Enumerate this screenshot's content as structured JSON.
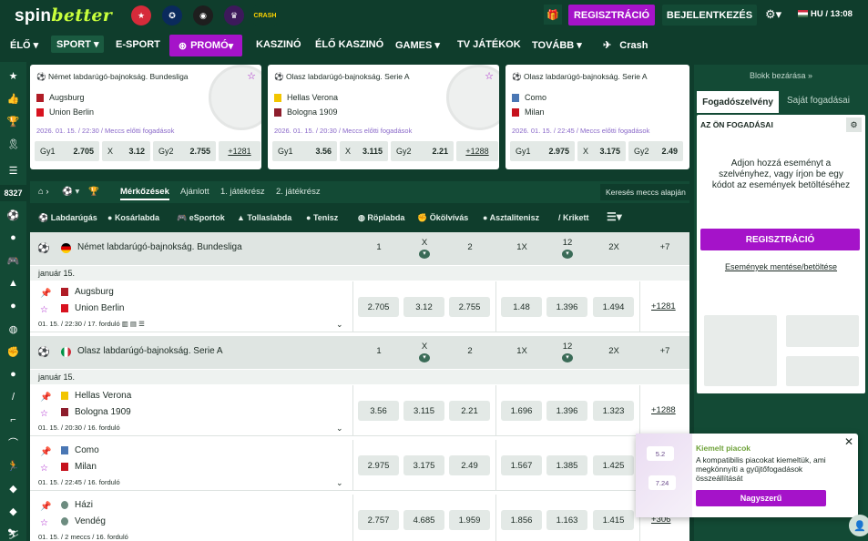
{
  "header": {
    "logo_a": "spin",
    "logo_b": "better",
    "register": "REGISZTRÁCIÓ",
    "login": "BEJELENTKEZÉS",
    "lang_time": "HU / 13:08",
    "crash_badge": "CRASH"
  },
  "nav": {
    "items": [
      "ÉLŐ",
      "SPORT",
      "E-SPORT",
      "PROMÓ",
      "KASZINÓ",
      "ÉLŐ KASZINÓ",
      "GAMES",
      "TV JÁTÉKOK",
      "TOVÁBB",
      "Crash"
    ]
  },
  "sidebar": {
    "count": "8327"
  },
  "cards": [
    {
      "league": "Német labdarúgó-bajnokság. Bundesliga",
      "home": "Augsburg",
      "away": "Union Berlin",
      "when": "2026. 01. 15. / 22:30 / Meccs előtti fogadások",
      "odds": [
        {
          "l": "Gy1",
          "v": "2.705"
        },
        {
          "l": "X",
          "v": "3.12"
        },
        {
          "l": "Gy2",
          "v": "2.755"
        }
      ],
      "more": "+1281"
    },
    {
      "league": "Olasz labdarúgó-bajnokság. Serie A",
      "home": "Hellas Verona",
      "away": "Bologna 1909",
      "when": "2026. 01. 15. / 20:30 / Meccs előtti fogadások",
      "odds": [
        {
          "l": "Gy1",
          "v": "3.56"
        },
        {
          "l": "X",
          "v": "3.115"
        },
        {
          "l": "Gy2",
          "v": "2.21"
        }
      ],
      "more": "+1288"
    },
    {
      "league": "Olasz labdarúgó-bajnokság. Serie A",
      "home": "Como",
      "away": "Milan",
      "when": "2026. 01. 15. / 22:45 / Meccs előtti fogadások",
      "odds": [
        {
          "l": "Gy1",
          "v": "2.975"
        },
        {
          "l": "X",
          "v": "3.175"
        },
        {
          "l": "Gy2",
          "v": "2.49"
        }
      ],
      "more": ""
    }
  ],
  "tabs": {
    "matches": "Mérkőzések",
    "recommended": "Ajánlott",
    "half1": "1. játékrész",
    "half2": "2. játékrész",
    "search": "Keresés meccs alapján"
  },
  "sports": [
    "Labdarúgás",
    "Kosárlabda",
    "eSportok",
    "Tollaslabda",
    "Tenisz",
    "Röplabda",
    "Ökölvívás",
    "Asztalitenisz",
    "Krikett"
  ],
  "col_heads": [
    "1",
    "X",
    "2",
    "1X",
    "12",
    "2X"
  ],
  "leagues": [
    {
      "name": "Német labdarúgó-bajnokság. Bundesliga",
      "plus": "+7",
      "date": "január 15.",
      "matches": [
        {
          "home": "Augsburg",
          "away": "Union Berlin",
          "info": "01. 15. / 22:30 / 17. forduló",
          "odds": [
            "2.705",
            "3.12",
            "2.755",
            "1.48",
            "1.396",
            "1.494"
          ],
          "more": "+1281"
        }
      ]
    },
    {
      "name": "Olasz labdarúgó-bajnokság. Serie A",
      "plus": "+7",
      "date": "január 15.",
      "matches": [
        {
          "home": "Hellas Verona",
          "away": "Bologna 1909",
          "info": "01. 15. / 20:30 / 16. forduló",
          "odds": [
            "3.56",
            "3.115",
            "2.21",
            "1.696",
            "1.396",
            "1.323"
          ],
          "more": "+1288"
        },
        {
          "home": "Como",
          "away": "Milan",
          "info": "01. 15. / 22:45 / 16. forduló",
          "odds": [
            "2.975",
            "3.175",
            "2.49",
            "1.567",
            "1.385",
            "1.425"
          ],
          "more": ""
        },
        {
          "home": "Házi",
          "away": "Vendég",
          "info": "01. 15. / 2 meccs / 16. forduló",
          "odds": [
            "2.757",
            "4.685",
            "1.959",
            "1.856",
            "1.163",
            "1.415"
          ],
          "more": "+306"
        }
      ]
    }
  ],
  "right": {
    "close": "Blokk bezárása »",
    "tab1": "Fogadószelvény",
    "tab2": "Saját fogadásai",
    "your_bets": "AZ ÖN FOGADÁSAI",
    "msg": "Adjon hozzá eseményt a szelvényhez, vagy írjon be egy kódot az események betöltéséhez",
    "register": "REGISZTRÁCIÓ",
    "save": "Események mentése/betöltése"
  },
  "toast": {
    "title": "Kiemelt piacok",
    "text": "A kompatibilis piacokat kiemeltük, ami megkönnyíti a gyűjtőfogadások összeállítását",
    "cta": "Nagyszerű",
    "chip1": "5.2",
    "chip2": "7.24"
  },
  "colors": {
    "bg": "#0f3d2c",
    "panel": "#134a35",
    "accent": "#a513c9"
  }
}
